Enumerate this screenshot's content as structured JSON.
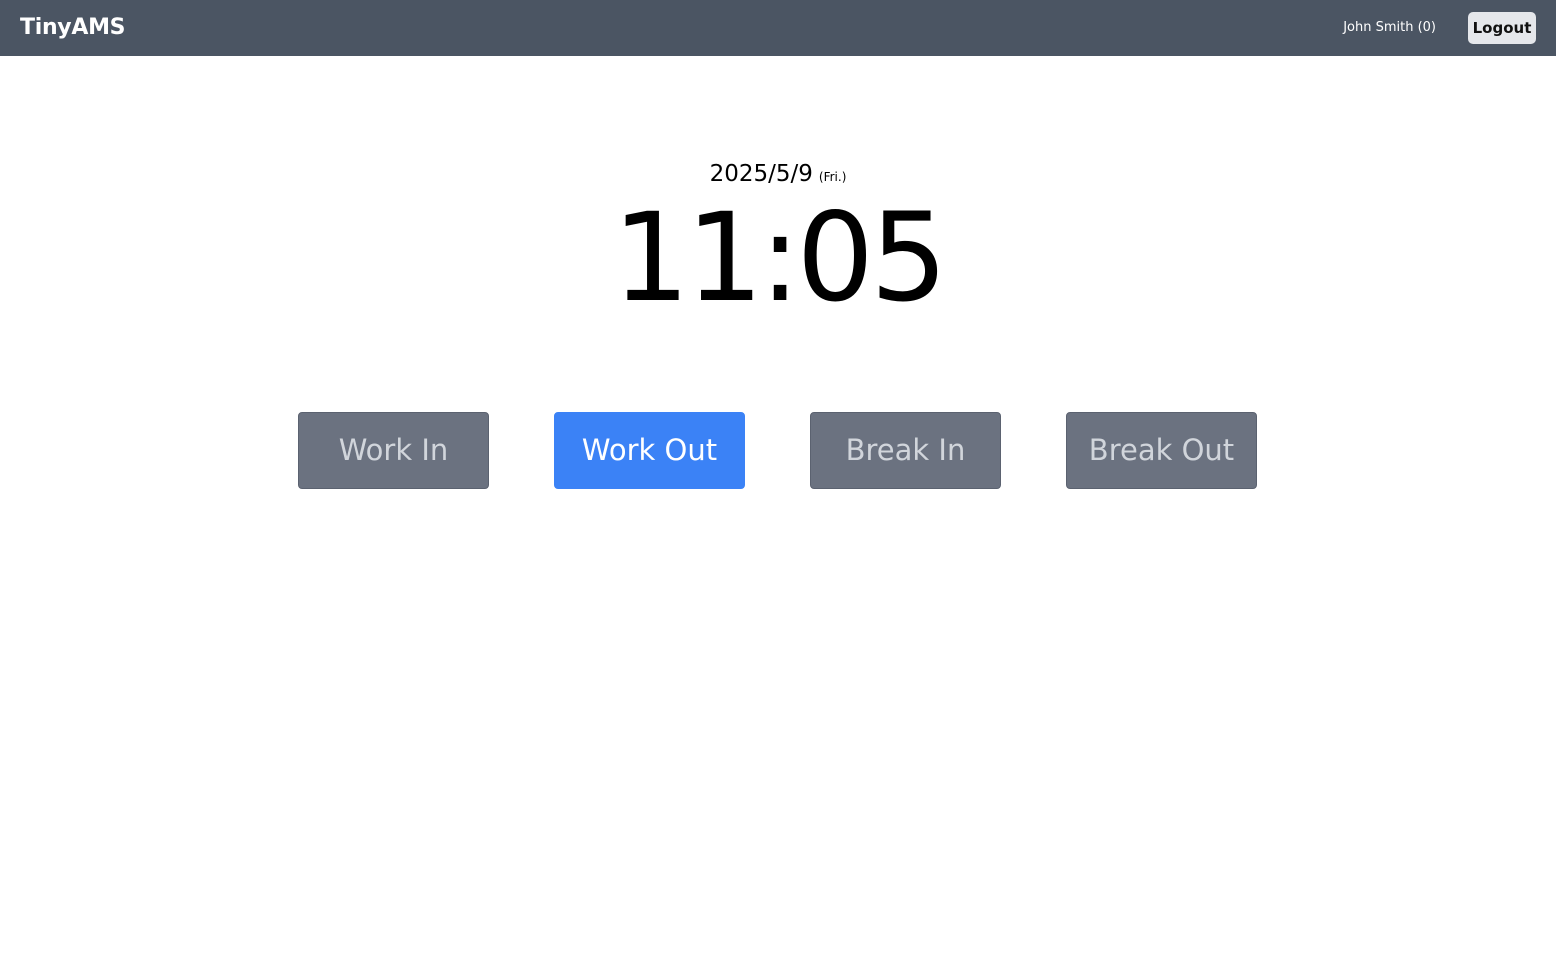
{
  "header": {
    "brand": "TinyAMS",
    "user_label": "John Smith (0)",
    "logout_label": "Logout"
  },
  "clock": {
    "date": "2025/5/9",
    "weekday": "(Fri.)",
    "time": "11:05"
  },
  "actions": [
    {
      "label": "Work In",
      "state": "inactive"
    },
    {
      "label": "Work Out",
      "state": "active"
    },
    {
      "label": "Break In",
      "state": "inactive"
    },
    {
      "label": "Break Out",
      "state": "inactive"
    }
  ],
  "colors": {
    "navbar": "#4b5563",
    "active_button": "#3b82f6",
    "inactive_button": "#6b7280",
    "inactive_text": "#d1d5db"
  }
}
